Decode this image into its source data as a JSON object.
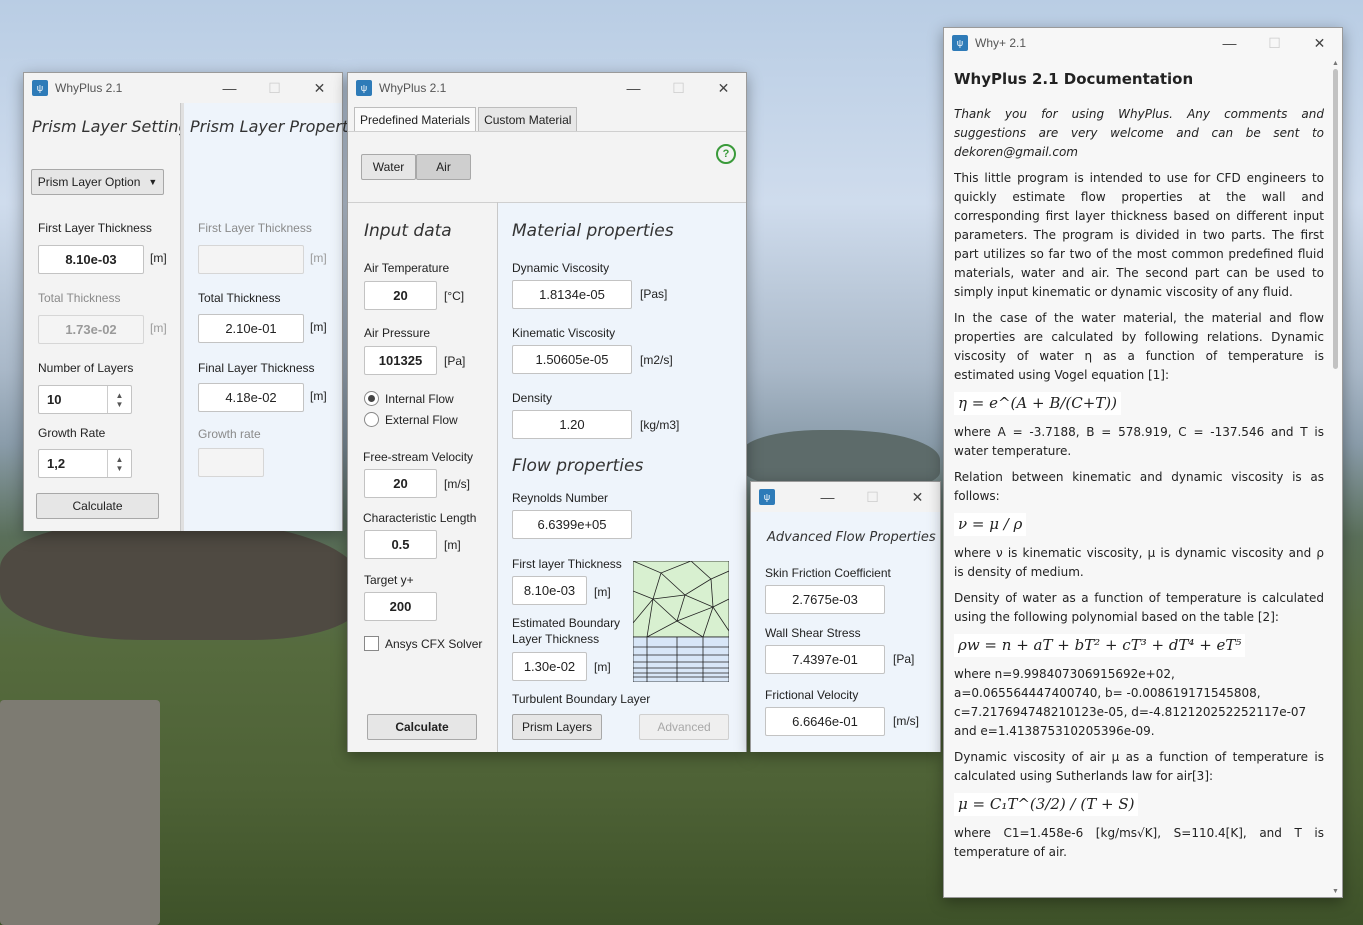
{
  "settings_window": {
    "title": "WhyPlus 2.1",
    "left_heading": "Prism Layer Settings",
    "right_heading": "Prism Layer Properties",
    "option_button": "Prism Layer Option",
    "first_layer_label": "First Layer Thickness",
    "first_layer_value": "8.10e-03",
    "unit_m": "[m]",
    "total_label": "Total Thickness",
    "total_value": "1.73e-02",
    "layers_label": "Number of Layers",
    "layers_value": "10",
    "growth_label": "Growth Rate",
    "growth_value": "1,2",
    "calculate": "Calculate",
    "prop_first_label": "First Layer Thickness",
    "prop_total_label": "Total Thickness",
    "prop_total_value": "2.10e-01",
    "prop_final_label": "Final Layer Thickness",
    "prop_final_value": "4.18e-02",
    "prop_growth_label": "Growth rate"
  },
  "main_window": {
    "title": "WhyPlus 2.1",
    "tabs": [
      "Predefined Materials",
      "Custom Material"
    ],
    "toggle": [
      "Water",
      "Air"
    ],
    "input_heading": "Input data",
    "air_temp_label": "Air Temperature",
    "air_temp_value": "20",
    "air_temp_unit": "[°C]",
    "air_pressure_label": "Air Pressure",
    "air_pressure_value": "101325",
    "air_pressure_unit": "[Pa]",
    "internal_flow": "Internal Flow",
    "external_flow": "External Flow",
    "velocity_label": "Free-stream Velocity",
    "velocity_value": "20",
    "velocity_unit": "[m/s]",
    "length_label": "Characteristic Length",
    "length_value": "0.5",
    "length_unit": "[m]",
    "yplus_label": "Target y+",
    "yplus_value": "200",
    "cfx_label": "Ansys CFX Solver",
    "calculate": "Calculate",
    "material_heading": "Material properties",
    "dyn_visc_label": "Dynamic Viscosity",
    "dyn_visc_value": "1.8134e-05",
    "dyn_visc_unit": "[Pas]",
    "kin_visc_label": "Kinematic Viscosity",
    "kin_visc_value": "1.50605e-05",
    "kin_visc_unit": "[m2/s]",
    "density_label": "Density",
    "density_value": "1.20",
    "density_unit": "[kg/m3]",
    "flow_heading": "Flow properties",
    "reynolds_label": "Reynolds Number",
    "reynolds_value": "6.6399e+05",
    "first_layer_label": "First layer Thickness",
    "first_layer_value": "8.10e-03",
    "first_layer_unit": "[m]",
    "boundary_label_1": "Estimated Boundary",
    "boundary_label_2": "Layer Thickness",
    "boundary_value": "1.30e-02",
    "boundary_unit": "[m]",
    "turbulent_label": "Turbulent Boundary Layer",
    "prism_button": "Prism Layers",
    "advanced_button": "Advanced",
    "help": "?"
  },
  "advanced_window": {
    "heading": "Advanced Flow Properties",
    "skin_label": "Skin Friction Coefficient",
    "skin_value": "2.7675e-03",
    "shear_label": "Wall Shear Stress",
    "shear_value": "7.4397e-01",
    "shear_unit": "[Pa]",
    "velocity_label": "Frictional Velocity",
    "velocity_value": "6.6646e-01",
    "velocity_unit": "[m/s]"
  },
  "doc_window": {
    "title": "Why+ 2.1",
    "heading": "WhyPlus 2.1 Documentation",
    "intro": "Thank you for using WhyPlus. Any comments and suggestions are very welcome and can be sent to dekoren@gmail.com",
    "p1": "This little program is intended to use for CFD engineers to quickly estimate flow properties at the wall and corresponding first layer thickness based on different input parameters. The program is divided in two parts. The first part utilizes so far two of the most common predefined fluid materials, water and air. The second part can be used to simply input kinematic or dynamic viscosity of any fluid.",
    "p2": "In the case of the water material, the material and flow properties are calculated by following relations. Dynamic viscosity of water η as a function of temperature is estimated using Vogel equation [1]:",
    "eq1": "η = e^(A + B/(C+T))",
    "p3": "where A = -3.7188, B = 578.919, C = -137.546 and T is water temperature.",
    "p4": "Relation between kinematic and dynamic viscosity is as follows:",
    "eq2": "ν = μ / ρ",
    "p5": "where ν is kinematic viscosity, μ is dynamic viscosity and ρ is density of medium.",
    "p6": "Density of water as a function of temperature is calculated using the following polynomial based on the table [2]:",
    "eq3": "ρw = n + aT + bT² + cT³ + dT⁴ + eT⁵",
    "p7": "where n=9.998407306915692e+02, a=0.065564447400740, b= -0.008619171545808, c=7.217694748210123e-05, d=-4.812120252252117e-07 and e=1.413875310205396e-09.",
    "p8": "Dynamic viscosity of air μ as a function of temperature is calculated using Sutherlands law for air[3]:",
    "eq4": "μ = C₁T^(3/2) / (T + S)",
    "p9": "where C1=1.458e-6 [kg/ms√K], S=110.4[K], and T is temperature of air."
  },
  "colors": {
    "panel_light_blue": "#eef4fb",
    "mesh_green": "#d8f0d0",
    "mesh_blue": "#d8e6f7",
    "app_icon": "#2e7bb8",
    "help_green": "#3a9a3a"
  }
}
